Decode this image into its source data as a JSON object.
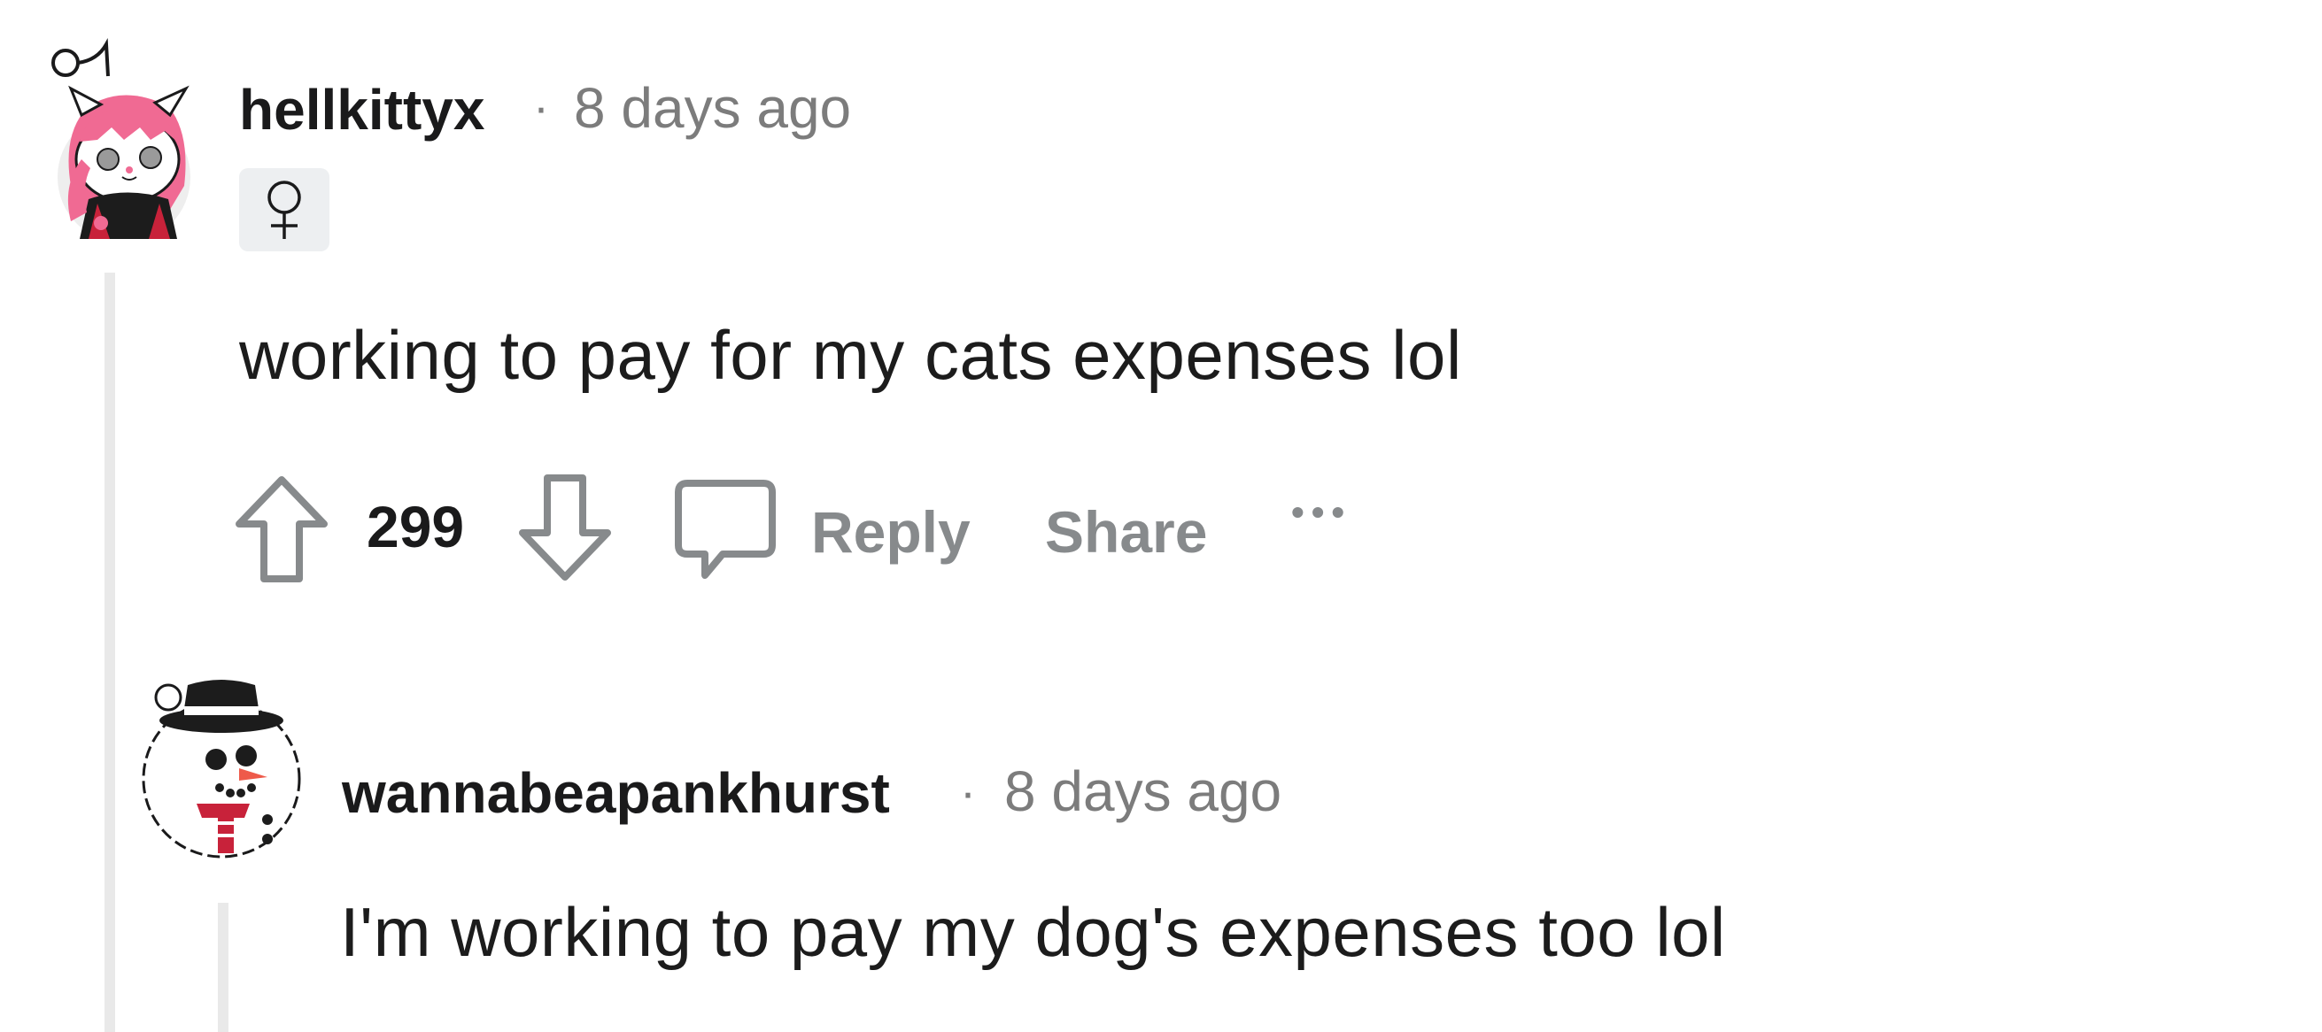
{
  "comments": [
    {
      "username": "hellkittyx",
      "timestamp": "8 days ago",
      "separator": "·",
      "flair": "♀",
      "body": "working to pay for my cats expenses lol",
      "vote_count": "299",
      "actions": {
        "reply": "Reply",
        "share": "Share",
        "more": "•••"
      }
    },
    {
      "username": "wannabeapankhurst",
      "timestamp": "8 days ago",
      "separator": "·",
      "body": "I'm working to pay my dog's expenses too lol"
    }
  ],
  "colors": {
    "text": "#1a1a1b",
    "muted": "#7c7c7c",
    "icon": "#878a8c",
    "thread_line": "#e9e9e9",
    "flair_bg": "#edeff1"
  }
}
